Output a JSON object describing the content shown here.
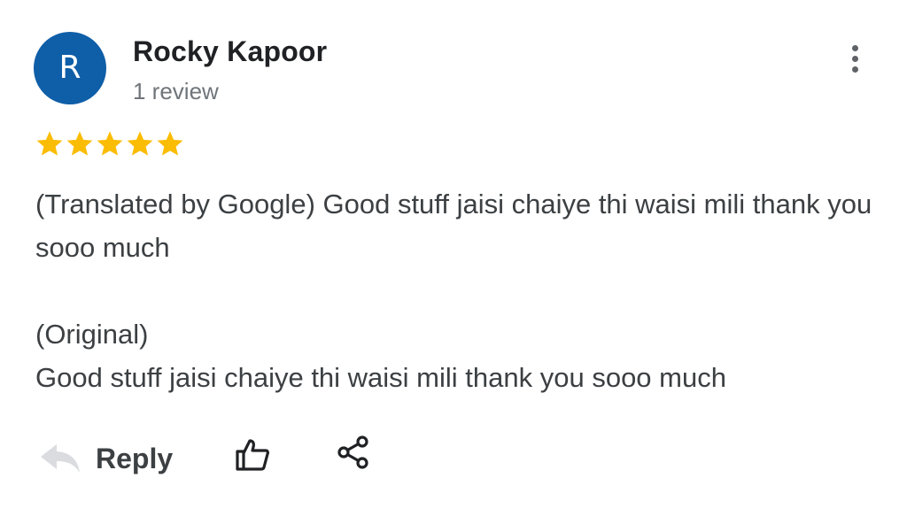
{
  "reviewer": {
    "initial": "R",
    "name": "Rocky Kapoor",
    "review_count": "1 review",
    "avatar_color": "#0f5ea8"
  },
  "rating": {
    "stars": 5,
    "max": 5,
    "star_color": "#fbbc04"
  },
  "review": {
    "translated_text": "(Translated by Google) Good stuff jaisi chaiye thi waisi mili thank you sooo much",
    "original_label": "(Original)",
    "original_text": "Good stuff jaisi chaiye thi waisi mili thank you sooo much"
  },
  "actions": {
    "reply_label": "Reply",
    "reply_icon": "reply-arrow-icon",
    "like_icon": "thumbs-up-icon",
    "share_icon": "share-icon",
    "more_icon": "more-vertical-icon"
  }
}
